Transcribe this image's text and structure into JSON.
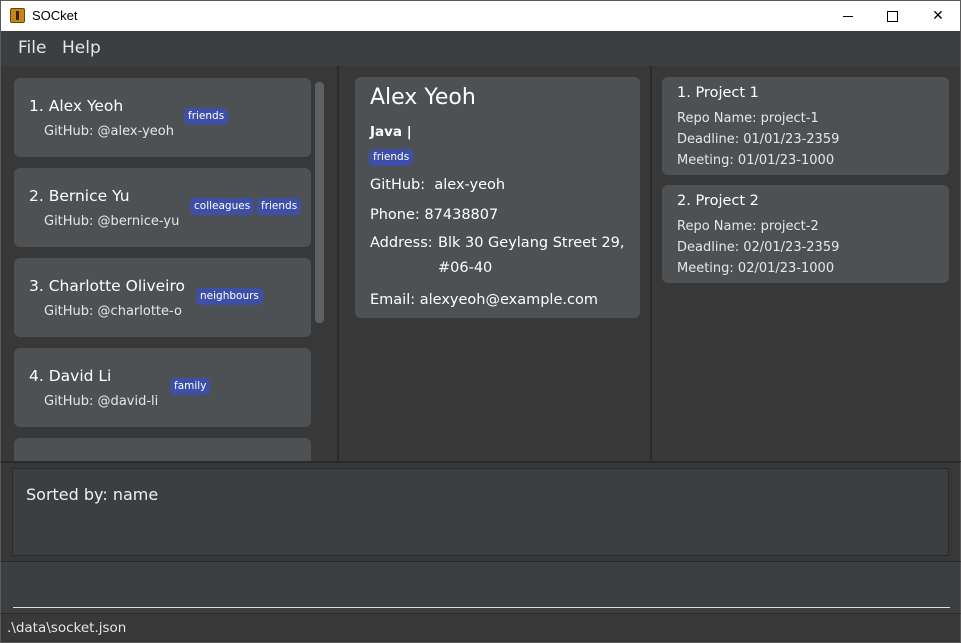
{
  "window": {
    "title": "SOCket",
    "minimize_glyph": "minimize-icon",
    "maximize_glyph": "maximize-icon",
    "close_glyph": "✕"
  },
  "menu": {
    "file": "File",
    "help": "Help"
  },
  "persons": [
    {
      "index_name": "1.  Alex Yeoh",
      "github": "GitHub: @alex-yeoh",
      "tags": [
        "friends"
      ]
    },
    {
      "index_name": "2.  Bernice Yu",
      "github": "GitHub: @bernice-yu",
      "tags": [
        "colleagues",
        "friends"
      ]
    },
    {
      "index_name": "3.  Charlotte Oliveiro",
      "github": "GitHub: @charlotte-o",
      "tags": [
        "neighbours"
      ]
    },
    {
      "index_name": "4.  David Li",
      "github": "GitHub: @david-li",
      "tags": [
        "family"
      ]
    }
  ],
  "detail": {
    "name": "Alex Yeoh",
    "languages": "Java |",
    "tag": "friends",
    "github_label": "GitHub:",
    "github_value": "alex-yeoh",
    "phone_label": "Phone:",
    "phone_value": "87438807",
    "address_label": "Address:",
    "address_value": "Blk 30 Geylang Street 29, #06-40",
    "email_label": "Email:",
    "email_value": "alexyeoh@example.com"
  },
  "projects": [
    {
      "title": "1.  Project 1",
      "repo": "Repo Name: project-1",
      "deadline": "Deadline: 01/01/23-2359",
      "meeting": "Meeting: 01/01/23-1000"
    },
    {
      "title": "2.  Project 2",
      "repo": "Repo Name: project-2",
      "deadline": "Deadline: 02/01/23-2359",
      "meeting": "Meeting: 02/01/23-1000"
    }
  ],
  "result": {
    "text": "Sorted by: name"
  },
  "command": {
    "value": "",
    "placeholder": ""
  },
  "status": {
    "path": ".\\data\\socket.json"
  },
  "colors": {
    "tag": "#3e4fa8",
    "card": "#4e5154",
    "background": "#383838"
  }
}
